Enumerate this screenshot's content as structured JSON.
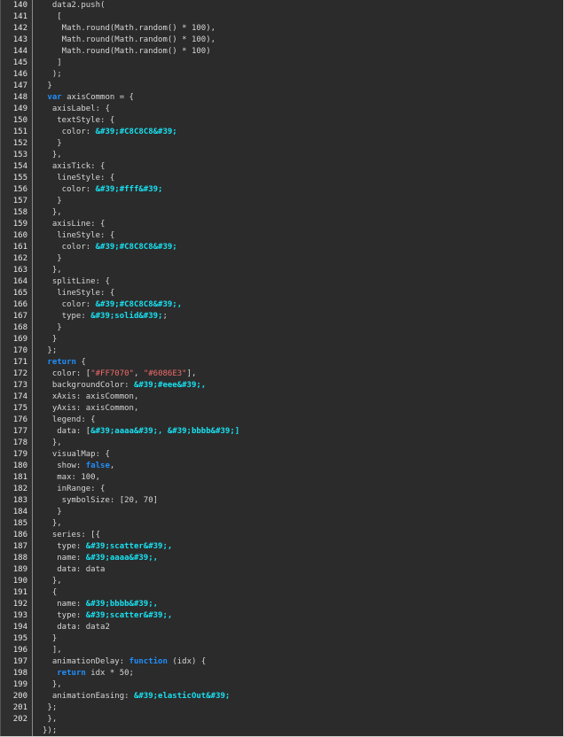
{
  "colors": {
    "background": "#2b2b2b",
    "gutter": "#2f2f2f",
    "text": "#d6d6d6",
    "keyword": "#1f8fff",
    "string": "#f06a6a",
    "entity": "#18e0f0"
  },
  "lines": [
    {
      "n": "140",
      "segments": [
        {
          "t": "  data2.push(",
          "c": "plain"
        }
      ]
    },
    {
      "n": "141",
      "segments": [
        {
          "t": "   [",
          "c": "plain"
        }
      ]
    },
    {
      "n": "142",
      "segments": [
        {
          "t": "    Math.round(Math.random() * 100),",
          "c": "plain"
        }
      ]
    },
    {
      "n": "143",
      "segments": [
        {
          "t": "    Math.round(Math.random() * 100),",
          "c": "plain"
        }
      ]
    },
    {
      "n": "144",
      "segments": [
        {
          "t": "    Math.round(Math.random() * 100)",
          "c": "plain"
        }
      ]
    },
    {
      "n": "145",
      "segments": [
        {
          "t": "   ]",
          "c": "plain"
        }
      ]
    },
    {
      "n": "146",
      "segments": [
        {
          "t": "  );",
          "c": "plain"
        }
      ]
    },
    {
      "n": "147",
      "segments": [
        {
          "t": " }",
          "c": "plain"
        }
      ]
    },
    {
      "n": "148",
      "segments": [
        {
          "t": " ",
          "c": "plain"
        },
        {
          "t": "var",
          "c": "kw"
        },
        {
          "t": " axisCommon = {",
          "c": "plain"
        }
      ]
    },
    {
      "n": "149",
      "segments": [
        {
          "t": "  axisLabel: {",
          "c": "plain"
        }
      ]
    },
    {
      "n": "150",
      "segments": [
        {
          "t": "   textStyle: {",
          "c": "plain"
        }
      ]
    },
    {
      "n": "151",
      "segments": [
        {
          "t": "    color: ",
          "c": "plain"
        },
        {
          "t": "&#39;#C8C8C8&#39;",
          "c": "ent"
        }
      ]
    },
    {
      "n": "152",
      "segments": [
        {
          "t": "   }",
          "c": "plain"
        }
      ]
    },
    {
      "n": "153",
      "segments": [
        {
          "t": "  },",
          "c": "plain"
        }
      ]
    },
    {
      "n": "154",
      "segments": [
        {
          "t": "  axisTick: {",
          "c": "plain"
        }
      ]
    },
    {
      "n": "155",
      "segments": [
        {
          "t": "   lineStyle: {",
          "c": "plain"
        }
      ]
    },
    {
      "n": "156",
      "segments": [
        {
          "t": "    color: ",
          "c": "plain"
        },
        {
          "t": "&#39;#fff&#39;",
          "c": "ent"
        }
      ]
    },
    {
      "n": "157",
      "segments": [
        {
          "t": "   }",
          "c": "plain"
        }
      ]
    },
    {
      "n": "158",
      "segments": [
        {
          "t": "  },",
          "c": "plain"
        }
      ]
    },
    {
      "n": "159",
      "segments": [
        {
          "t": "  axisLine: {",
          "c": "plain"
        }
      ]
    },
    {
      "n": "160",
      "segments": [
        {
          "t": "   lineStyle: {",
          "c": "plain"
        }
      ]
    },
    {
      "n": "161",
      "segments": [
        {
          "t": "    color: ",
          "c": "plain"
        },
        {
          "t": "&#39;#C8C8C8&#39;",
          "c": "ent"
        }
      ]
    },
    {
      "n": "162",
      "segments": [
        {
          "t": "   }",
          "c": "plain"
        }
      ]
    },
    {
      "n": "163",
      "segments": [
        {
          "t": "  },",
          "c": "plain"
        }
      ]
    },
    {
      "n": "164",
      "segments": [
        {
          "t": "  splitLine: {",
          "c": "plain"
        }
      ]
    },
    {
      "n": "165",
      "segments": [
        {
          "t": "   lineStyle: {",
          "c": "plain"
        }
      ]
    },
    {
      "n": "166",
      "segments": [
        {
          "t": "    color: ",
          "c": "plain"
        },
        {
          "t": "&#39;#C8C8C8&#39;,",
          "c": "ent"
        }
      ]
    },
    {
      "n": "167",
      "segments": [
        {
          "t": "    type: ",
          "c": "plain"
        },
        {
          "t": "&#39;solid&#39;",
          "c": "ent"
        },
        {
          "t": ";",
          "c": "plain"
        }
      ]
    },
    {
      "n": "168",
      "segments": [
        {
          "t": "   }",
          "c": "plain"
        }
      ]
    },
    {
      "n": "169",
      "segments": [
        {
          "t": "  }",
          "c": "plain"
        }
      ]
    },
    {
      "n": "170",
      "segments": [
        {
          "t": " };",
          "c": "plain"
        }
      ]
    },
    {
      "n": "171",
      "segments": [
        {
          "t": " ",
          "c": "plain"
        },
        {
          "t": "return",
          "c": "kw"
        },
        {
          "t": " {",
          "c": "plain"
        }
      ]
    },
    {
      "n": "172",
      "segments": [
        {
          "t": "  color: [",
          "c": "plain"
        },
        {
          "t": "\"#FF7070\"",
          "c": "str"
        },
        {
          "t": ", ",
          "c": "plain"
        },
        {
          "t": "\"#6086E3\"",
          "c": "str"
        },
        {
          "t": "],",
          "c": "plain"
        }
      ]
    },
    {
      "n": "173",
      "segments": [
        {
          "t": "  backgroundColor: ",
          "c": "plain"
        },
        {
          "t": "&#39;#eee&#39;,",
          "c": "ent"
        }
      ]
    },
    {
      "n": "174",
      "segments": [
        {
          "t": "  xAxis: axisCommon,",
          "c": "plain"
        }
      ]
    },
    {
      "n": "175",
      "segments": [
        {
          "t": "  yAxis: axisCommon,",
          "c": "plain"
        }
      ]
    },
    {
      "n": "176",
      "segments": [
        {
          "t": "  legend: {",
          "c": "plain"
        }
      ]
    },
    {
      "n": "177",
      "segments": [
        {
          "t": "   data: [",
          "c": "plain"
        },
        {
          "t": "&#39;aaaa&#39;, &#39;bbbb&#39;]",
          "c": "ent"
        }
      ]
    },
    {
      "n": "178",
      "segments": [
        {
          "t": "  },",
          "c": "plain"
        }
      ]
    },
    {
      "n": "179",
      "segments": [
        {
          "t": "  visualMap: {",
          "c": "plain"
        }
      ]
    },
    {
      "n": "180",
      "segments": [
        {
          "t": "   show: ",
          "c": "plain"
        },
        {
          "t": "false",
          "c": "kw"
        },
        {
          "t": ",",
          "c": "plain"
        }
      ]
    },
    {
      "n": "181",
      "segments": [
        {
          "t": "   max: 100,",
          "c": "plain"
        }
      ]
    },
    {
      "n": "182",
      "segments": [
        {
          "t": "   inRange: {",
          "c": "plain"
        }
      ]
    },
    {
      "n": "183",
      "segments": [
        {
          "t": "    symbolSize: [20, 70]",
          "c": "plain"
        }
      ]
    },
    {
      "n": "184",
      "segments": [
        {
          "t": "   }",
          "c": "plain"
        }
      ]
    },
    {
      "n": "185",
      "segments": [
        {
          "t": "  },",
          "c": "plain"
        }
      ]
    },
    {
      "n": "186",
      "segments": [
        {
          "t": "  series: [{",
          "c": "plain"
        }
      ]
    },
    {
      "n": "187",
      "segments": [
        {
          "t": "   type: ",
          "c": "plain"
        },
        {
          "t": "&#39;scatter&#39;,",
          "c": "ent"
        }
      ]
    },
    {
      "n": "188",
      "segments": [
        {
          "t": "   name: ",
          "c": "plain"
        },
        {
          "t": "&#39;aaaa&#39;,",
          "c": "ent"
        }
      ]
    },
    {
      "n": "189",
      "segments": [
        {
          "t": "   data: data",
          "c": "plain"
        }
      ]
    },
    {
      "n": "190",
      "segments": [
        {
          "t": "  },",
          "c": "plain"
        }
      ]
    },
    {
      "n": "191",
      "segments": [
        {
          "t": "  {",
          "c": "plain"
        }
      ]
    },
    {
      "n": "192",
      "segments": [
        {
          "t": "   name: ",
          "c": "plain"
        },
        {
          "t": "&#39;bbbb&#39;,",
          "c": "ent"
        }
      ]
    },
    {
      "n": "193",
      "segments": [
        {
          "t": "   type: ",
          "c": "plain"
        },
        {
          "t": "&#39;scatter&#39;,",
          "c": "ent"
        }
      ]
    },
    {
      "n": "194",
      "segments": [
        {
          "t": "   data: data2",
          "c": "plain"
        }
      ]
    },
    {
      "n": "195",
      "segments": [
        {
          "t": "  }",
          "c": "plain"
        }
      ]
    },
    {
      "n": "196",
      "segments": [
        {
          "t": "  ],",
          "c": "plain"
        }
      ]
    },
    {
      "n": "197",
      "segments": [
        {
          "t": "  animationDelay: ",
          "c": "plain"
        },
        {
          "t": "function",
          "c": "kw"
        },
        {
          "t": " (idx) {",
          "c": "plain"
        }
      ]
    },
    {
      "n": "198",
      "segments": [
        {
          "t": "   ",
          "c": "plain"
        },
        {
          "t": "return",
          "c": "kw"
        },
        {
          "t": " idx * 50;",
          "c": "plain"
        }
      ]
    },
    {
      "n": "199",
      "segments": [
        {
          "t": "  },",
          "c": "plain"
        }
      ]
    },
    {
      "n": "200",
      "segments": [
        {
          "t": "  animationEasing: ",
          "c": "plain"
        },
        {
          "t": "&#39;elasticOut&#39;",
          "c": "ent"
        }
      ]
    },
    {
      "n": "201",
      "segments": [
        {
          "t": " };",
          "c": "plain"
        }
      ]
    },
    {
      "n": "202",
      "segments": [
        {
          "t": " },",
          "c": "plain"
        }
      ]
    },
    {
      "n": "",
      "segments": [
        {
          "t": "});",
          "c": "plain"
        }
      ]
    }
  ]
}
